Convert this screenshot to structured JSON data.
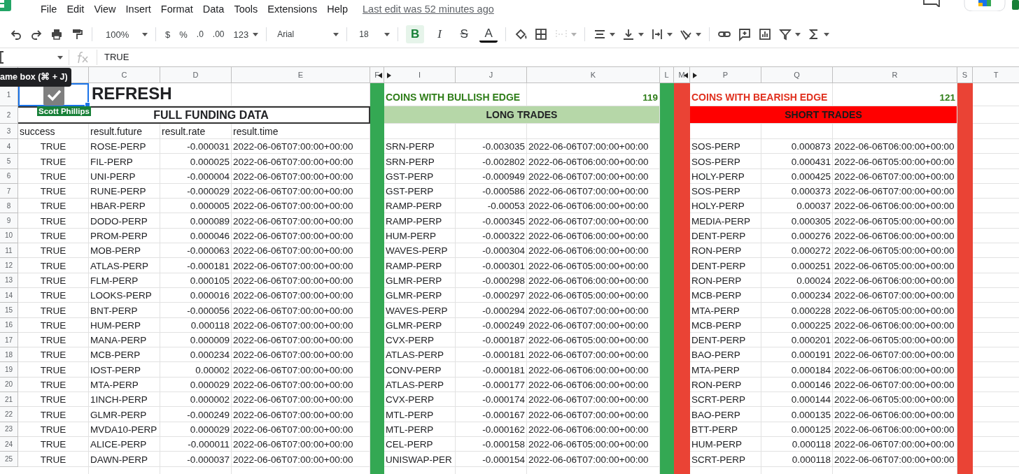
{
  "menu": {
    "items": [
      "File",
      "Edit",
      "View",
      "Insert",
      "Format",
      "Data",
      "Tools",
      "Extensions",
      "Help"
    ],
    "last_edit": "Last edit was 52 minutes ago"
  },
  "toolbar": {
    "zoom": "100%",
    "currency": "$",
    "percent": "%",
    "decimal_decrease": ".0",
    "decimal_increase": ".00",
    "number_format": "123",
    "font": "Arial",
    "font_size": "18",
    "bold": {
      "label": "B",
      "selected": true
    },
    "italic": "I",
    "strikethrough": "S",
    "text_color": "A",
    "merge": {
      "disabled": true
    }
  },
  "formula_bar": {
    "value": "TRUE"
  },
  "tooltip": "ame box (⌘ + J)",
  "column_headers": [
    {
      "label": "C"
    },
    {
      "label": "D"
    },
    {
      "label": "E"
    },
    {
      "label": "F",
      "collapse": true
    },
    {
      "label": "I",
      "expand": true
    },
    {
      "label": "J"
    },
    {
      "label": "K"
    },
    {
      "label": "L"
    },
    {
      "label": "M",
      "collapse": true
    },
    {
      "label": "P",
      "expand": true
    },
    {
      "label": "Q"
    },
    {
      "label": "R"
    },
    {
      "label": "S"
    },
    {
      "label": "T"
    }
  ],
  "row_numbers": [
    "1",
    "2",
    "3",
    "4",
    "5",
    "6",
    "7",
    "8",
    "9",
    "10",
    "11",
    "12",
    "13",
    "14",
    "15",
    "16",
    "17",
    "18",
    "19",
    "20",
    "21",
    "22",
    "23",
    "24",
    "25"
  ],
  "refresh": {
    "checked": true,
    "title": "REFRESH",
    "collaborator": "Scott Phillips"
  },
  "funding": {
    "title": "FULL FUNDING DATA",
    "columns": [
      "success",
      "result.future",
      "result.rate",
      "result.time"
    ],
    "rows": [
      [
        "TRUE",
        "ROSE-PERP",
        "-0.000031",
        "2022-06-06T07:00:00+00:00"
      ],
      [
        "TRUE",
        "FIL-PERP",
        "0.000025",
        "2022-06-06T07:00:00+00:00"
      ],
      [
        "TRUE",
        "UNI-PERP",
        "-0.000004",
        "2022-06-06T07:00:00+00:00"
      ],
      [
        "TRUE",
        "RUNE-PERP",
        "-0.000029",
        "2022-06-06T07:00:00+00:00"
      ],
      [
        "TRUE",
        "HBAR-PERP",
        "0.000005",
        "2022-06-06T07:00:00+00:00"
      ],
      [
        "TRUE",
        "DODO-PERP",
        "0.000089",
        "2022-06-06T07:00:00+00:00"
      ],
      [
        "TRUE",
        "PROM-PERP",
        "0.000046",
        "2022-06-06T07:00:00+00:00"
      ],
      [
        "TRUE",
        "MOB-PERP",
        "-0.000063",
        "2022-06-06T07:00:00+00:00"
      ],
      [
        "TRUE",
        "ATLAS-PERP",
        "-0.000181",
        "2022-06-06T07:00:00+00:00"
      ],
      [
        "TRUE",
        "FLM-PERP",
        "0.000105",
        "2022-06-06T07:00:00+00:00"
      ],
      [
        "TRUE",
        "LOOKS-PERP",
        "0.000016",
        "2022-06-06T07:00:00+00:00"
      ],
      [
        "TRUE",
        "BNT-PERP",
        "-0.000056",
        "2022-06-06T07:00:00+00:00"
      ],
      [
        "TRUE",
        "HUM-PERP",
        "0.000118",
        "2022-06-06T07:00:00+00:00"
      ],
      [
        "TRUE",
        "MANA-PERP",
        "0.000009",
        "2022-06-06T07:00:00+00:00"
      ],
      [
        "TRUE",
        "MCB-PERP",
        "0.000234",
        "2022-06-06T07:00:00+00:00"
      ],
      [
        "TRUE",
        "IOST-PERP",
        "0.00002",
        "2022-06-06T07:00:00+00:00"
      ],
      [
        "TRUE",
        "MTA-PERP",
        "0.000029",
        "2022-06-06T07:00:00+00:00"
      ],
      [
        "TRUE",
        "1INCH-PERP",
        "0.000002",
        "2022-06-06T07:00:00+00:00"
      ],
      [
        "TRUE",
        "GLMR-PERP",
        "-0.000249",
        "2022-06-06T07:00:00+00:00"
      ],
      [
        "TRUE",
        "MVDA10-PERP",
        "0.000029",
        "2022-06-06T07:00:00+00:00"
      ],
      [
        "TRUE",
        "ALICE-PERP",
        "-0.000011",
        "2022-06-06T07:00:00+00:00"
      ],
      [
        "TRUE",
        "DAWN-PERP",
        "-0.000037",
        "2022-06-06T07:00:00+00:00"
      ]
    ]
  },
  "long": {
    "title": "COINS WITH BULLISH EDGE",
    "count": "119",
    "band": "LONG TRADES",
    "rows": [
      [
        "SRN-PERP",
        "-0.003035",
        "2022-06-06T07:00:00+00:00"
      ],
      [
        "SRN-PERP",
        "-0.002802",
        "2022-06-06T06:00:00+00:00"
      ],
      [
        "GST-PERP",
        "-0.000949",
        "2022-06-06T07:00:00+00:00"
      ],
      [
        "GST-PERP",
        "-0.000586",
        "2022-06-06T07:00:00+00:00"
      ],
      [
        "RAMP-PERP",
        "-0.00053",
        "2022-06-06T06:00:00+00:00"
      ],
      [
        "RAMP-PERP",
        "-0.000345",
        "2022-06-06T07:00:00+00:00"
      ],
      [
        "HUM-PERP",
        "-0.000322",
        "2022-06-06T06:00:00+00:00"
      ],
      [
        "WAVES-PERP",
        "-0.000304",
        "2022-06-06T06:00:00+00:00"
      ],
      [
        "RAMP-PERP",
        "-0.000301",
        "2022-06-06T05:00:00+00:00"
      ],
      [
        "GLMR-PERP",
        "-0.000298",
        "2022-06-06T06:00:00+00:00"
      ],
      [
        "GLMR-PERP",
        "-0.000297",
        "2022-06-06T05:00:00+00:00"
      ],
      [
        "WAVES-PERP",
        "-0.000294",
        "2022-06-06T07:00:00+00:00"
      ],
      [
        "GLMR-PERP",
        "-0.000249",
        "2022-06-06T07:00:00+00:00"
      ],
      [
        "CVX-PERP",
        "-0.000187",
        "2022-06-06T05:00:00+00:00"
      ],
      [
        "ATLAS-PERP",
        "-0.000181",
        "2022-06-06T07:00:00+00:00"
      ],
      [
        "CONV-PERP",
        "-0.000181",
        "2022-06-06T06:00:00+00:00"
      ],
      [
        "ATLAS-PERP",
        "-0.000177",
        "2022-06-06T06:00:00+00:00"
      ],
      [
        "CVX-PERP",
        "-0.000174",
        "2022-06-06T07:00:00+00:00"
      ],
      [
        "MTL-PERP",
        "-0.000167",
        "2022-06-06T07:00:00+00:00"
      ],
      [
        "MTL-PERP",
        "-0.000162",
        "2022-06-06T06:00:00+00:00"
      ],
      [
        "CEL-PERP",
        "-0.000158",
        "2022-06-06T05:00:00+00:00"
      ],
      [
        "UNISWAP-PER",
        "-0.000154",
        "2022-06-06T07:00:00+00:00"
      ]
    ]
  },
  "short": {
    "title": "COINS WITH BEARISH EDGE",
    "count": "121",
    "band": "SHORT TRADES",
    "rows": [
      [
        "SOS-PERP",
        "0.000873",
        "2022-06-06T06:00:00+00:00"
      ],
      [
        "SOS-PERP",
        "0.000431",
        "2022-06-06T05:00:00+00:00"
      ],
      [
        "HOLY-PERP",
        "0.000425",
        "2022-06-06T07:00:00+00:00"
      ],
      [
        "SOS-PERP",
        "0.000373",
        "2022-06-06T07:00:00+00:00"
      ],
      [
        "HOLY-PERP",
        "0.00037",
        "2022-06-06T06:00:00+00:00"
      ],
      [
        "MEDIA-PERP",
        "0.000305",
        "2022-06-06T05:00:00+00:00"
      ],
      [
        "DENT-PERP",
        "0.000276",
        "2022-06-06T06:00:00+00:00"
      ],
      [
        "RON-PERP",
        "0.000272",
        "2022-06-06T05:00:00+00:00"
      ],
      [
        "DENT-PERP",
        "0.000251",
        "2022-06-06T05:00:00+00:00"
      ],
      [
        "RON-PERP",
        "0.00024",
        "2022-06-06T06:00:00+00:00"
      ],
      [
        "MCB-PERP",
        "0.000234",
        "2022-06-06T07:00:00+00:00"
      ],
      [
        "MTA-PERP",
        "0.000228",
        "2022-06-06T05:00:00+00:00"
      ],
      [
        "MCB-PERP",
        "0.000225",
        "2022-06-06T06:00:00+00:00"
      ],
      [
        "DENT-PERP",
        "0.000201",
        "2022-06-06T05:00:00+00:00"
      ],
      [
        "BAO-PERP",
        "0.000191",
        "2022-06-06T07:00:00+00:00"
      ],
      [
        "MTA-PERP",
        "0.000184",
        "2022-06-06T06:00:00+00:00"
      ],
      [
        "RON-PERP",
        "0.000146",
        "2022-06-06T07:00:00+00:00"
      ],
      [
        "SCRT-PERP",
        "0.000144",
        "2022-06-06T05:00:00+00:00"
      ],
      [
        "BAO-PERP",
        "0.000135",
        "2022-06-06T06:00:00+00:00"
      ],
      [
        "BTT-PERP",
        "0.000125",
        "2022-06-06T06:00:00+00:00"
      ],
      [
        "HUM-PERP",
        "0.000118",
        "2022-06-06T07:00:00+00:00"
      ],
      [
        "SCRT-PERP",
        "0.000118",
        "2022-06-06T07:00:00+00:00"
      ]
    ]
  }
}
